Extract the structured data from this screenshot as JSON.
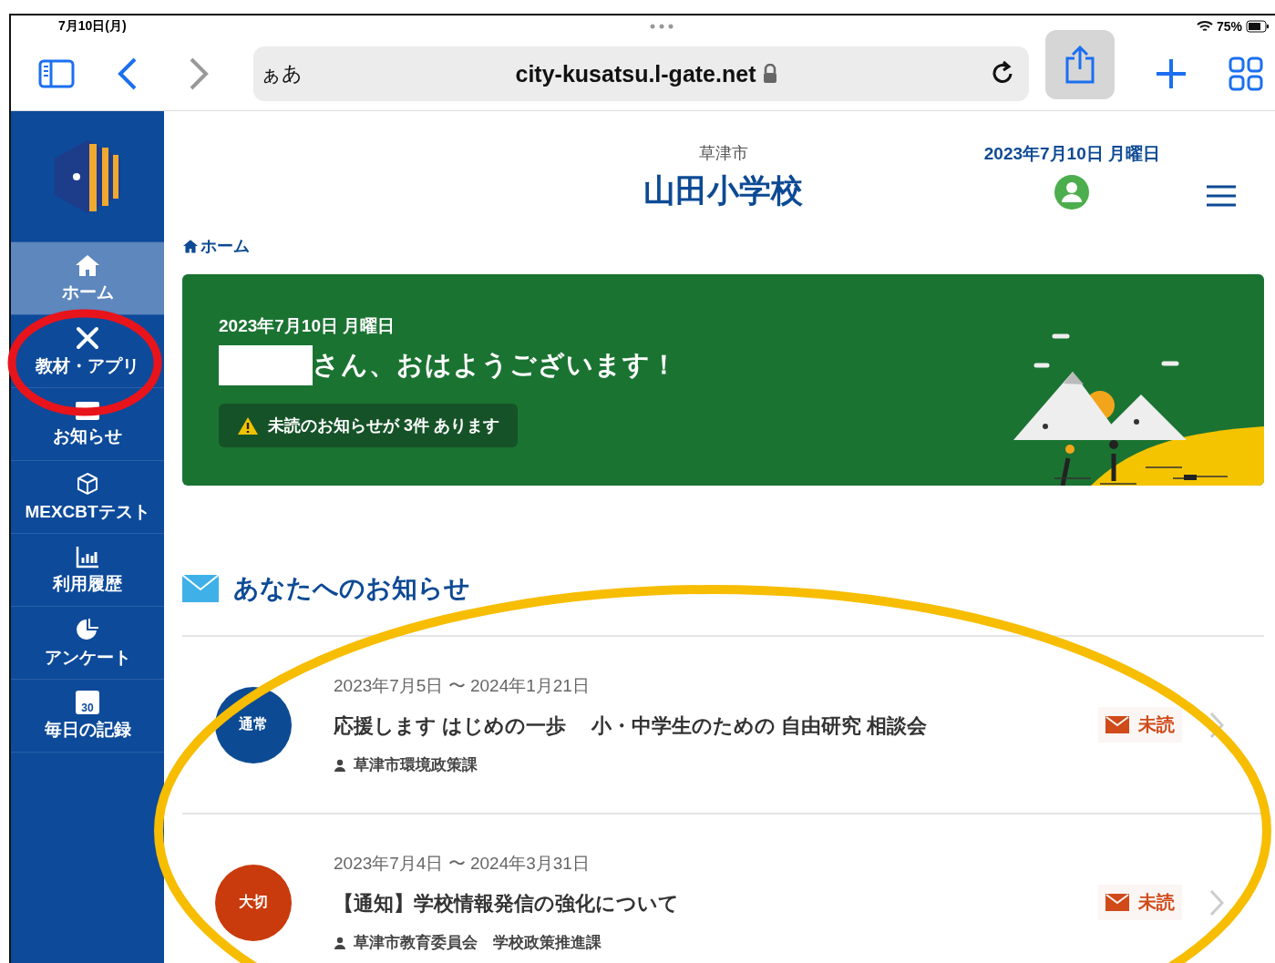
{
  "status_bar": {
    "date": "7月10日(月)",
    "battery": "75%"
  },
  "browser": {
    "text_size": "ぁあ",
    "url": "city-kusatsu.l-gate.net"
  },
  "sidebar": {
    "items": [
      {
        "kind": "home",
        "label": "ホーム",
        "selected": true
      },
      {
        "kind": "tools",
        "label": "教材・アプリ",
        "selected": false
      },
      {
        "kind": "notice",
        "label": "お知らせ",
        "selected": false
      },
      {
        "kind": "cube",
        "label": "MEXCBTテスト",
        "selected": false
      },
      {
        "kind": "chart",
        "label": "利用履歴",
        "selected": false
      },
      {
        "kind": "pie",
        "label": "アンケート",
        "selected": false
      },
      {
        "kind": "calendar",
        "label": "毎日の記録",
        "calendar_day": "30",
        "selected": false
      }
    ]
  },
  "header": {
    "city": "草津市",
    "school": "山田小学校",
    "date": "2023年7月10日 月曜日"
  },
  "breadcrumb": "ホーム",
  "banner": {
    "date": "2023年7月10日 月曜日",
    "greeting": "さん、おはようございます！",
    "alert": "未読のお知らせが 3件 あります"
  },
  "section_title": "あなたへのお知らせ",
  "notices": [
    {
      "badge": "通常",
      "color": "#0d4a94",
      "period": "2023年7月5日 〜 2024年1月21日",
      "title": "応援します はじめの一歩　 小・中学生のための 自由研究 相談会",
      "sender": "草津市環境政策課",
      "status": "未読"
    },
    {
      "badge": "大切",
      "color": "#c93a0c",
      "period": "2023年7月4日 〜 2024年3月31日",
      "title": "【通知】学校情報発信の強化について",
      "sender": "草津市教育委員会　学校政策推進課",
      "status": "未読"
    }
  ],
  "annotations": [
    {
      "kind": "circle",
      "color": "#e8141c"
    },
    {
      "kind": "ellipse",
      "color": "#f7bd00"
    }
  ]
}
